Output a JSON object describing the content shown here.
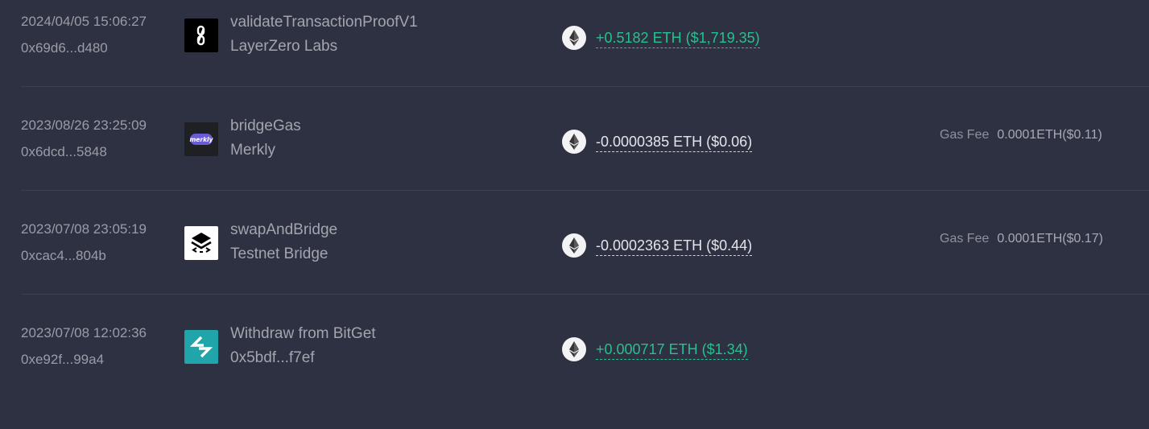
{
  "transactions": [
    {
      "date": "2024/04/05 15:06:27",
      "hash": "0x69d6...d480",
      "method": "validateTransactionProofV1",
      "project": "LayerZero Labs",
      "logo_icon": "layerzero-logo-icon",
      "amount": "+0.5182 ETH ($1,719.35)",
      "direction": "positive",
      "token_icon": "ethereum-icon",
      "gas_label": "",
      "gas_value": ""
    },
    {
      "date": "2023/08/26 23:25:09",
      "hash": "0x6dcd...5848",
      "method": "bridgeGas",
      "project": "Merkly",
      "logo_icon": "merkly-logo-icon",
      "logo_text": "merkly",
      "amount": "-0.0000385 ETH ($0.06)",
      "direction": "negative",
      "token_icon": "ethereum-icon",
      "gas_label": "Gas Fee",
      "gas_value": "0.0001ETH($0.11)"
    },
    {
      "date": "2023/07/08 23:05:19",
      "hash": "0xcac4...804b",
      "method": "swapAndBridge",
      "project": "Testnet Bridge",
      "logo_icon": "testnet-bridge-logo-icon",
      "amount": "-0.0002363 ETH ($0.44)",
      "direction": "negative",
      "token_icon": "ethereum-icon",
      "gas_label": "Gas Fee",
      "gas_value": "0.0001ETH($0.17)"
    },
    {
      "date": "2023/07/08 12:02:36",
      "hash": "0xe92f...99a4",
      "method": "Withdraw from BitGet",
      "project": "0x5bdf...f7ef",
      "logo_icon": "bitget-logo-icon",
      "amount": "+0.000717 ETH ($1.34)",
      "direction": "positive",
      "token_icon": "ethereum-icon",
      "gas_label": "",
      "gas_value": ""
    }
  ],
  "colors": {
    "background": "#2d3142",
    "positive": "#27c08f",
    "negative": "#e4e5ea",
    "divider": "#3c4052",
    "bitget": "#1fa5aa"
  }
}
